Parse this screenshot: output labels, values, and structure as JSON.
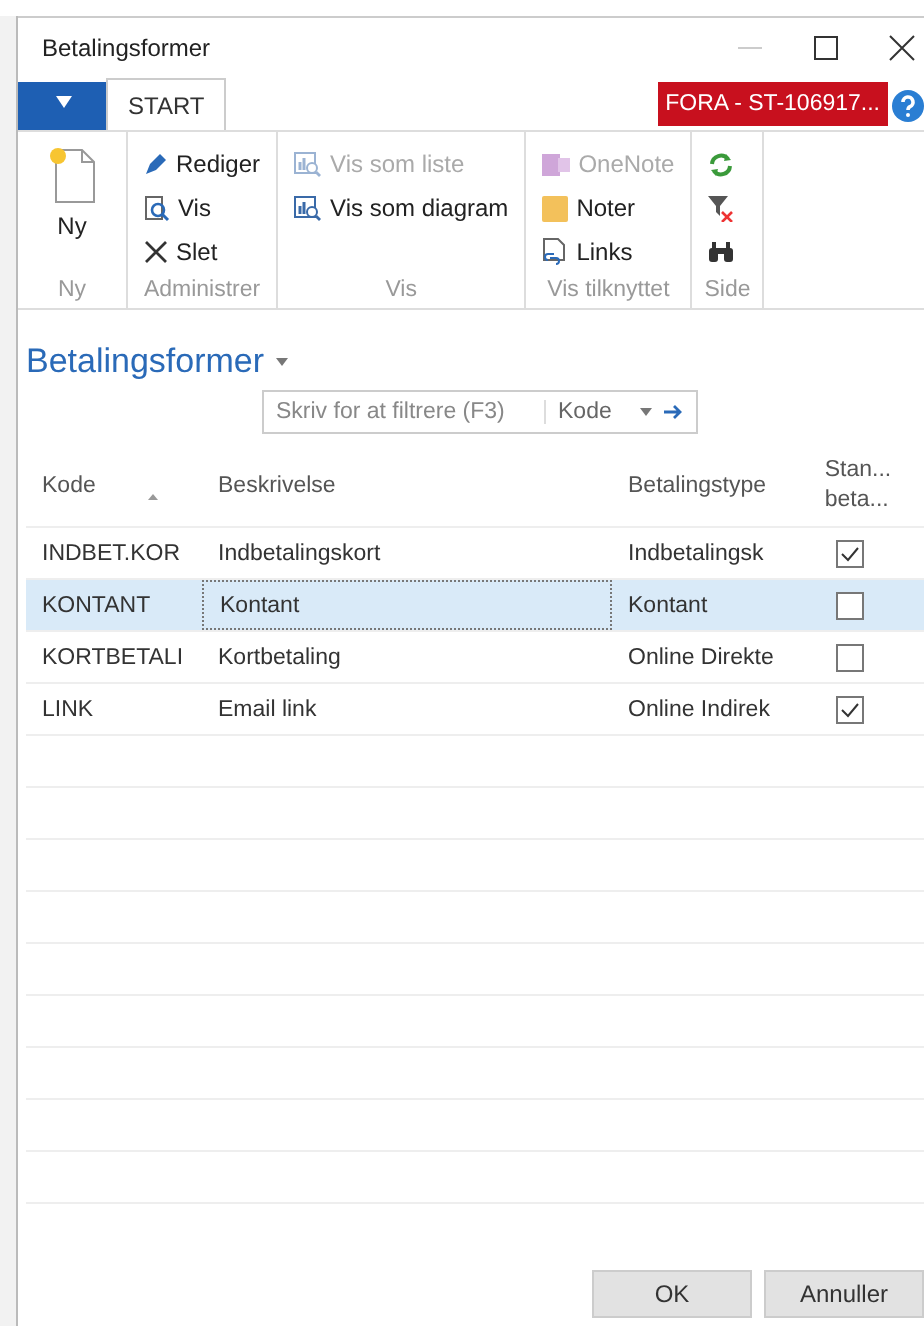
{
  "window": {
    "title": "Betalingsformer"
  },
  "tabs": [
    {
      "label": "START",
      "selected": true
    }
  ],
  "company_badge": "FORA - ST-106917...",
  "ribbon": [
    {
      "group": "Ny",
      "items": [
        {
          "label": "Ny",
          "kind": "new",
          "disabled": false
        }
      ],
      "large": true
    },
    {
      "group": "Administrer",
      "items": [
        {
          "label": "Rediger",
          "kind": "edit",
          "disabled": false
        },
        {
          "label": "Vis",
          "kind": "view",
          "disabled": false
        },
        {
          "label": "Slet",
          "kind": "delete",
          "disabled": false
        }
      ]
    },
    {
      "group": "Vis",
      "items": [
        {
          "label": "Vis som liste",
          "kind": "list",
          "disabled": true
        },
        {
          "label": "Vis som diagram",
          "kind": "chart",
          "disabled": false
        }
      ]
    },
    {
      "group": "Vis tilknyttet",
      "items": [
        {
          "label": "OneNote",
          "kind": "onenote",
          "disabled": true
        },
        {
          "label": "Noter",
          "kind": "note",
          "disabled": false
        },
        {
          "label": "Links",
          "kind": "link",
          "disabled": false
        }
      ]
    },
    {
      "group": "Side",
      "items": [
        {
          "kind": "refresh",
          "disabled": false
        },
        {
          "kind": "clearfilter",
          "disabled": false
        },
        {
          "kind": "find",
          "disabled": false
        }
      ]
    }
  ],
  "page_title": "Betalingsformer",
  "filter": {
    "placeholder": "Skriv for at filtrere (F3)",
    "field": "Kode"
  },
  "table": {
    "columns": [
      "Kode",
      "Beskrivelse",
      "Betalingstype",
      "Stan...\nbeta..."
    ],
    "rows": [
      {
        "code": "INDBET.KOR",
        "description": "Indbetalingskort",
        "type": "Indbetalingsk",
        "checked": true,
        "selected": false
      },
      {
        "code": "KONTANT",
        "description": "Kontant",
        "type": "Kontant",
        "checked": false,
        "selected": true
      },
      {
        "code": "KORTBETALI",
        "description": "Kortbetaling",
        "type": "Online Direkte",
        "checked": false,
        "selected": false
      },
      {
        "code": "LINK",
        "description": "Email link",
        "type": "Online Indirek",
        "checked": true,
        "selected": false
      }
    ]
  },
  "buttons": [
    "OK",
    "Annuller"
  ]
}
